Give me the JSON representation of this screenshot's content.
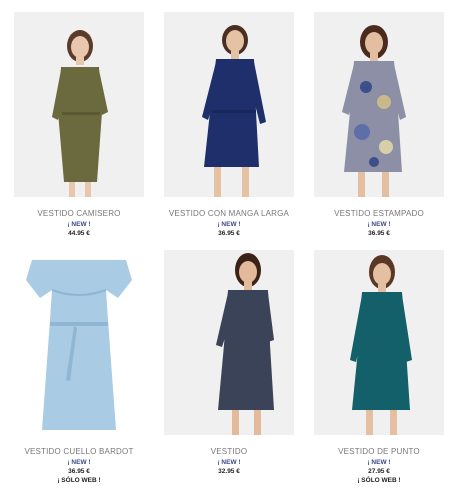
{
  "products": [
    {
      "name": "VESTIDO CAMISERO",
      "badge": "¡ NEW !",
      "price": "44.95 €",
      "colors": {
        "dress": "#6b6a3e",
        "bg": "#f0f0f0"
      }
    },
    {
      "name": "VESTIDO CON MANGA LARGA",
      "badge": "¡ NEW !",
      "price": "36.95 €",
      "colors": {
        "dress": "#1f2f6b",
        "bg": "#f0f0f0"
      }
    },
    {
      "name": "VESTIDO ESTAMPADO",
      "badge": "¡ NEW !",
      "price": "36.95 €",
      "colors": {
        "dress": "#8c8fa6",
        "bg": "#f0f0f0"
      }
    },
    {
      "name": "VESTIDO CUELLO BARDOT",
      "badge": "¡ NEW !",
      "price": "36.95 €",
      "web": "¡ SÓLO WEB !",
      "colors": {
        "dress": "#a9cbe3",
        "bg": "#ffffff"
      }
    },
    {
      "name": "VESTIDO",
      "badge": "¡ NEW !",
      "price": "32.95 €",
      "colors": {
        "dress": "#3a4358",
        "bg": "#f0f0f0"
      }
    },
    {
      "name": "VESTIDO DE PUNTO",
      "badge": "¡ NEW !",
      "price": "27.95 €",
      "web": "¡ SÓLO WEB !",
      "colors": {
        "dress": "#13606a",
        "bg": "#f0f0f0"
      }
    }
  ]
}
